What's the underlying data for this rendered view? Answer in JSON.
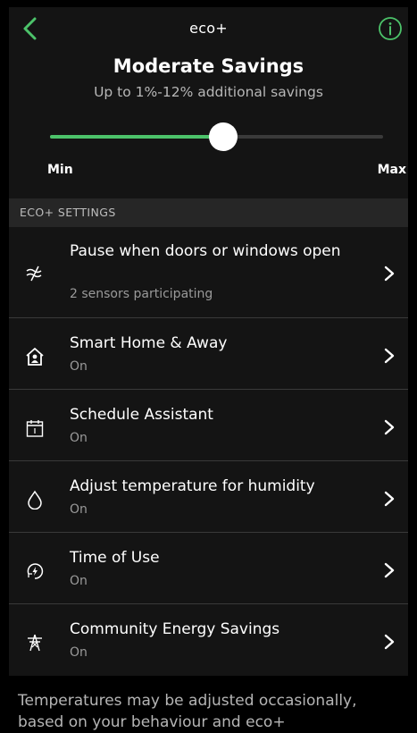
{
  "header": {
    "title": "eco+",
    "back_icon": "chevron-left-icon",
    "info_icon": "info-icon",
    "accent_color": "#4cc36a"
  },
  "savings": {
    "title": "Moderate Savings",
    "subtitle": "Up to 1%-12% additional savings",
    "slider": {
      "value": 0.52,
      "min_label": "Min",
      "max_label": "Max"
    }
  },
  "section": {
    "header": "ECO+ SETTINGS"
  },
  "settings": [
    {
      "label": "Pause when doors or windows open",
      "status": "2 sensors participating",
      "icon": "window-sensor-icon"
    },
    {
      "label": "Smart Home & Away",
      "status": "On",
      "icon": "home-person-icon"
    },
    {
      "label": "Schedule Assistant",
      "status": "On",
      "icon": "calendar-icon"
    },
    {
      "label": "Adjust temperature for humidity",
      "status": "On",
      "icon": "water-drop-icon"
    },
    {
      "label": "Time of Use",
      "status": "On",
      "icon": "lightning-clock-icon"
    },
    {
      "label": "Community Energy Savings",
      "status": "On",
      "icon": "power-tower-icon"
    }
  ],
  "footer": {
    "text": "Temperatures may be adjusted occasionally, based on your behaviour and eco+"
  }
}
